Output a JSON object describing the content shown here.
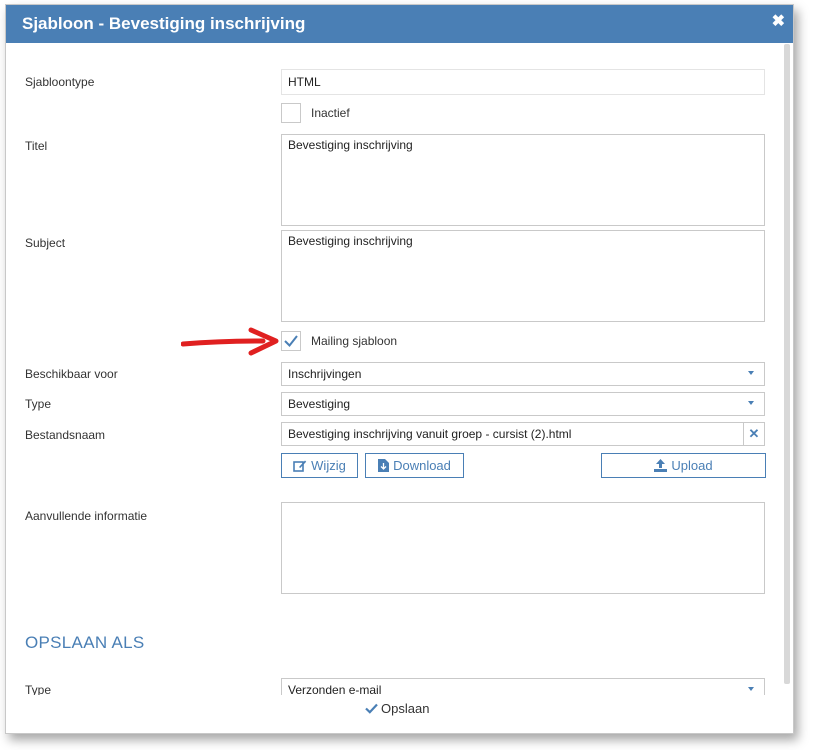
{
  "dialog": {
    "title": "Sjabloon - Bevestiging inschrijving",
    "close_icon": "close-icon"
  },
  "form": {
    "sjabloontype_label": "Sjabloontype",
    "sjabloontype_value": "HTML",
    "inactief_label": "Inactief",
    "inactief_checked": false,
    "titel_label": "Titel",
    "titel_value": "Bevestiging inschrijving",
    "subject_label": "Subject",
    "subject_value": "Bevestiging inschrijving",
    "mailing_label": "Mailing sjabloon",
    "mailing_checked": true,
    "beschikbaar_label": "Beschikbaar voor",
    "beschikbaar_value": "Inschrijvingen",
    "type_label": "Type",
    "type_value": "Bevestiging",
    "bestandsnaam_label": "Bestandsnaam",
    "bestandsnaam_value": "Bevestiging inschrijving vanuit groep - cursist (2).html",
    "wijzig_label": "Wijzig",
    "download_label": "Download",
    "upload_label": "Upload",
    "aanvullende_label": "Aanvullende informatie",
    "aanvullende_value": ""
  },
  "opslaan_als": {
    "section_title": "OPSLAAN ALS",
    "type_label": "Type",
    "type_value": "Verzonden e-mail"
  },
  "footer": {
    "save_label": "Opslaan"
  },
  "colors": {
    "accent": "#4a7fb5",
    "annotation_arrow": "#e02020"
  }
}
